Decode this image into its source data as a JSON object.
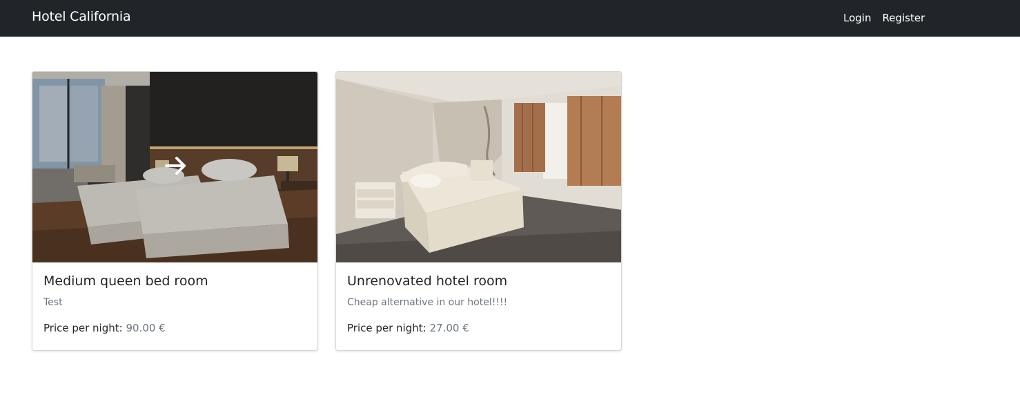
{
  "navbar": {
    "brand": "Hotel California",
    "links": [
      {
        "label": "Login"
      },
      {
        "label": "Register"
      }
    ]
  },
  "rooms": [
    {
      "title": "Medium queen bed room",
      "description": "Test",
      "price_label": "Price per night:",
      "price_value": "90.00 €",
      "image_icon": "arrow-right-icon"
    },
    {
      "title": "Unrenovated hotel room",
      "description": "Cheap alternative in our hotel!!!!",
      "price_label": "Price per night:",
      "price_value": "27.00 €"
    }
  ],
  "colors": {
    "navbar_bg": "#212529",
    "navbar_text": "#ffffff",
    "muted_text": "#6c757d"
  }
}
